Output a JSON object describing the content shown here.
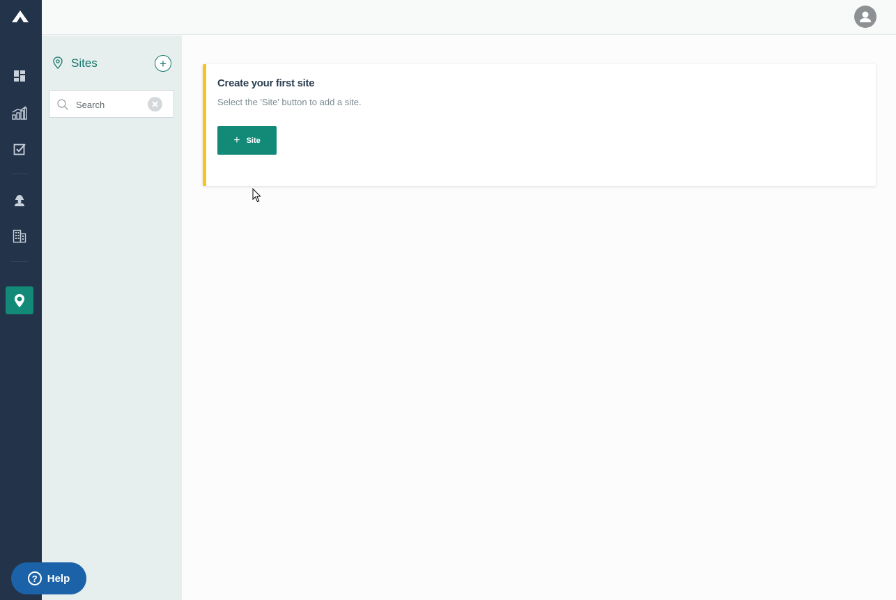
{
  "nav": {
    "items": [
      {
        "icon": "dashboard-icon",
        "active": false
      },
      {
        "icon": "analytics-icon",
        "active": false
      },
      {
        "icon": "tasks-icon",
        "active": false
      },
      {
        "icon": "worker-icon",
        "active": false
      },
      {
        "icon": "buildings-icon",
        "active": false
      },
      {
        "icon": "location-pin-icon",
        "active": true
      }
    ]
  },
  "sidebar": {
    "title": "Sites",
    "search": {
      "placeholder": "Search",
      "value": ""
    }
  },
  "card": {
    "title": "Create your first site",
    "subtitle": "Select the 'Site' button to add a site.",
    "button_plus": "+",
    "button_label": "Site"
  },
  "help": {
    "icon_glyph": "?",
    "label": "Help"
  },
  "colors": {
    "nav_bg": "#22334a",
    "accent": "#138a78",
    "card_border": "#f4c51f",
    "sidebar_bg": "#e6efee",
    "help_bg": "#1b62a8"
  }
}
